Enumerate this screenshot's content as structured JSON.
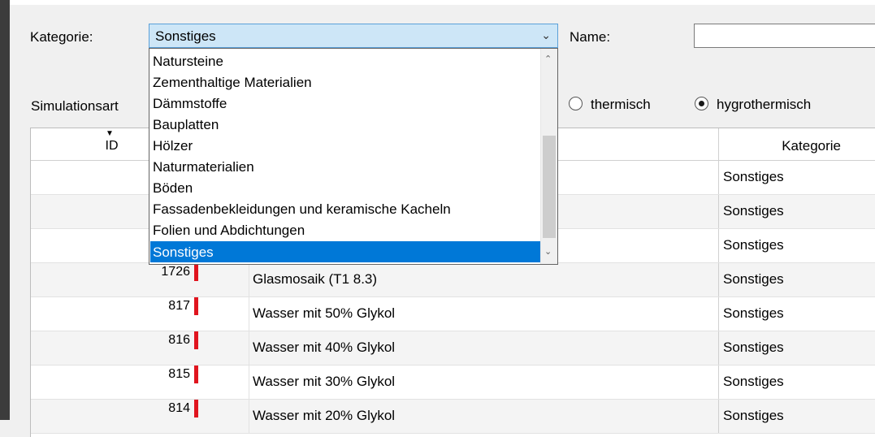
{
  "form": {
    "kategorie_label": "Kategorie:",
    "kategorie_value": "Sonstiges",
    "name_label": "Name:",
    "name_value": "",
    "simulationsart_label": "Simulationsart",
    "radio_thermisch": "thermisch",
    "radio_hygrothermisch": "hygrothermisch",
    "selected_radio": "hygrothermisch"
  },
  "dropdown": {
    "items": [
      {
        "label": "Natursteine"
      },
      {
        "label": "Zementhaltige Materialien"
      },
      {
        "label": "Dämmstoffe"
      },
      {
        "label": "Bauplatten"
      },
      {
        "label": "Hölzer"
      },
      {
        "label": "Naturmaterialien"
      },
      {
        "label": "Böden"
      },
      {
        "label": "Fassadenbekleidungen und keramische Kacheln"
      },
      {
        "label": "Folien und Abdichtungen"
      },
      {
        "label": "Sonstiges"
      }
    ],
    "selected": "Sonstiges"
  },
  "table": {
    "headers": {
      "id": "ID",
      "kategorie": "Kategorie"
    },
    "rows": [
      {
        "id": "",
        "name": "",
        "kategorie": "Sonstiges"
      },
      {
        "id": "",
        "name": "",
        "kategorie": "Sonstiges"
      },
      {
        "id": "",
        "name": "",
        "kategorie": "Sonstiges"
      },
      {
        "id": "1726",
        "name": "Glasmosaik (T1 8.3)",
        "kategorie": "Sonstiges"
      },
      {
        "id": "817",
        "name": "Wasser mit 50% Glykol",
        "kategorie": "Sonstiges"
      },
      {
        "id": "816",
        "name": "Wasser mit 40% Glykol",
        "kategorie": "Sonstiges"
      },
      {
        "id": "815",
        "name": "Wasser mit 30% Glykol",
        "kategorie": "Sonstiges"
      },
      {
        "id": "814",
        "name": "Wasser mit 20% Glykol",
        "kategorie": "Sonstiges"
      }
    ]
  },
  "colors": {
    "selection": "#0078d7",
    "status_marker": "#e0141e",
    "combo_background": "#cde6f7"
  }
}
